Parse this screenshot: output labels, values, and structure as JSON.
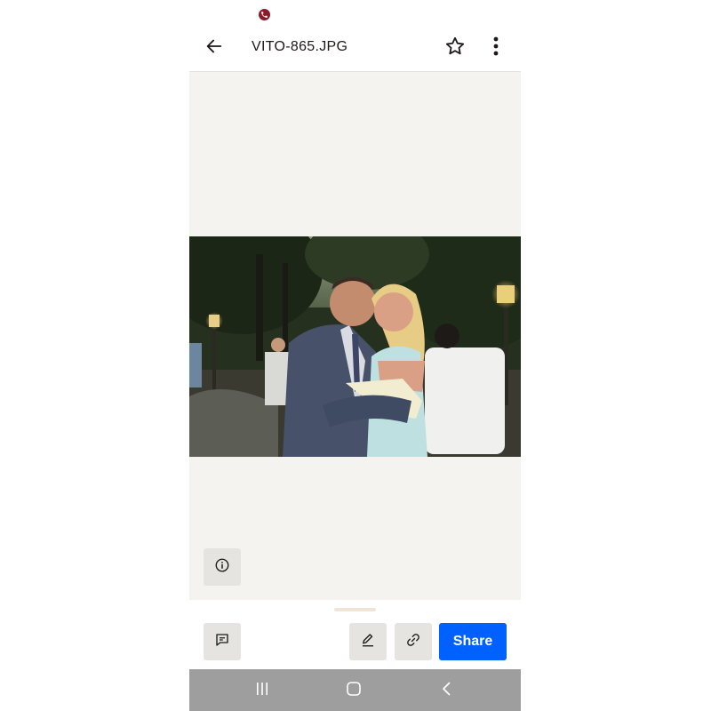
{
  "app_bar": {
    "title": "VITO-865.JPG",
    "back_icon": "arrow-left-icon",
    "star_icon": "star-outline-icon",
    "more_icon": "more-vertical-icon"
  },
  "status_bar": {
    "call_icon": "phone-call-icon"
  },
  "viewer": {
    "background_color": "#f5f3f0",
    "info_icon": "info-icon"
  },
  "bottom_sheet": {
    "comment_icon": "comment-icon",
    "edit_icon": "pencil-icon",
    "link_icon": "link-icon",
    "share_label": "Share",
    "share_color": "#0061fe"
  },
  "nav_bar": {
    "recents_icon": "recents-icon",
    "home_icon": "home-icon",
    "back_icon": "back-chevron-icon"
  }
}
